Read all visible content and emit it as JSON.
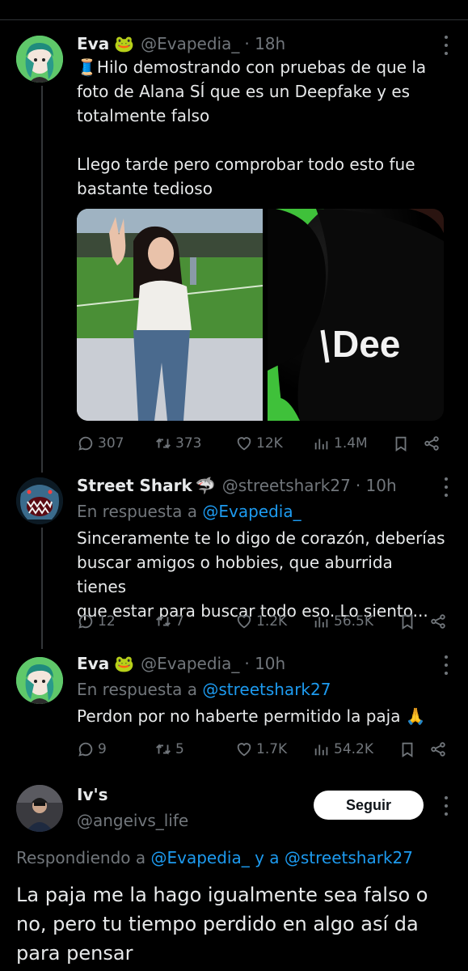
{
  "tweets": [
    {
      "name": "Eva",
      "name_emoji": "🐸",
      "handle": "@Evapedia_",
      "time": "· 18h",
      "text_lines": [
        "🧵Hilo demostrando con pruebas de que la",
        "foto de Alana SÍ que es un Deepfake y es",
        "totalmente falso",
        "",
        "Llego tarde pero comprobar todo esto fue",
        "bastante tedioso"
      ],
      "media_text": "Dee",
      "replies": "307",
      "retweets": "373",
      "likes": "12K",
      "views": "1.4M"
    },
    {
      "name": "Street Shark",
      "name_emoji": "🦈",
      "handle": "@streetshark27",
      "time": "· 10h",
      "reply_label": "En respuesta a",
      "reply_handle": "@Evapedia_",
      "text_lines": [
        "Sinceramente te lo digo de corazón, deberías",
        "buscar amigos o hobbies, que aburrida tienes",
        "que estar para buscar todo eso. Lo siento..."
      ],
      "replies": "12",
      "retweets": "7",
      "likes": "1.2K",
      "views": "56.5K"
    },
    {
      "name": "Eva",
      "name_emoji": "🐸",
      "handle": "@Evapedia_",
      "time": "· 10h",
      "reply_label": "En respuesta a",
      "reply_handle": "@streetshark27",
      "text_lines": [
        "Perdon por no haberte permitido la paja 🙏"
      ],
      "replies": "9",
      "retweets": "5",
      "likes": "1.7K",
      "views": "54.2K"
    }
  ],
  "focused": {
    "name": "Iv's",
    "handle": "@angeivs_life",
    "follow_label": "Seguir",
    "replying_label": "Respondiendo a",
    "replying_handle_1": "@Evapedia_",
    "replying_and": "y a",
    "replying_handle_2": "@streetshark27",
    "text_lines": [
      "La paja me la hago igualmente sea falso o",
      "no, pero tu tiempo perdido en algo así da",
      "para pensar"
    ]
  },
  "icons": [
    "reply-icon",
    "retweet-icon",
    "like-icon",
    "views-icon",
    "bookmark-icon",
    "share-icon",
    "more-icon"
  ]
}
